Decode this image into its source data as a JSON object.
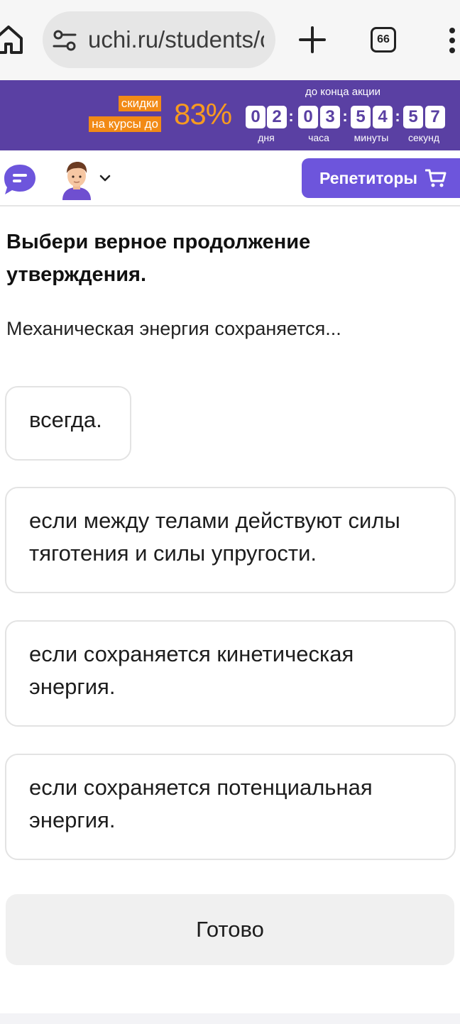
{
  "browser": {
    "url": "uchi.ru/students/c",
    "tab_count": "66"
  },
  "promo": {
    "label_line1": "скидки",
    "label_line2": "на курсы до",
    "percent": "83%",
    "caption": "до конца акции",
    "digits": [
      "0",
      "2",
      "0",
      "3",
      "5",
      "4",
      "5",
      "7"
    ],
    "units": [
      "дня",
      "часа",
      "минуты",
      "секунд"
    ],
    "colors": {
      "banner": "#5a40a3",
      "accent": "#f28a16"
    }
  },
  "header": {
    "tutors_label": "Репетиторы",
    "tutors_color": "#6d55dc"
  },
  "question": {
    "title": "Выбери верное продолжение утверждения.",
    "text": "Механическая энергия сохраняется..."
  },
  "answers": [
    {
      "label": "всегда."
    },
    {
      "label": "если между телами действуют силы тяготения и силы упругости."
    },
    {
      "label": "если сохраняется кинетическая энергия."
    },
    {
      "label": "если сохраняется потенциальная энергия."
    }
  ],
  "submit": {
    "label": "Готово"
  }
}
